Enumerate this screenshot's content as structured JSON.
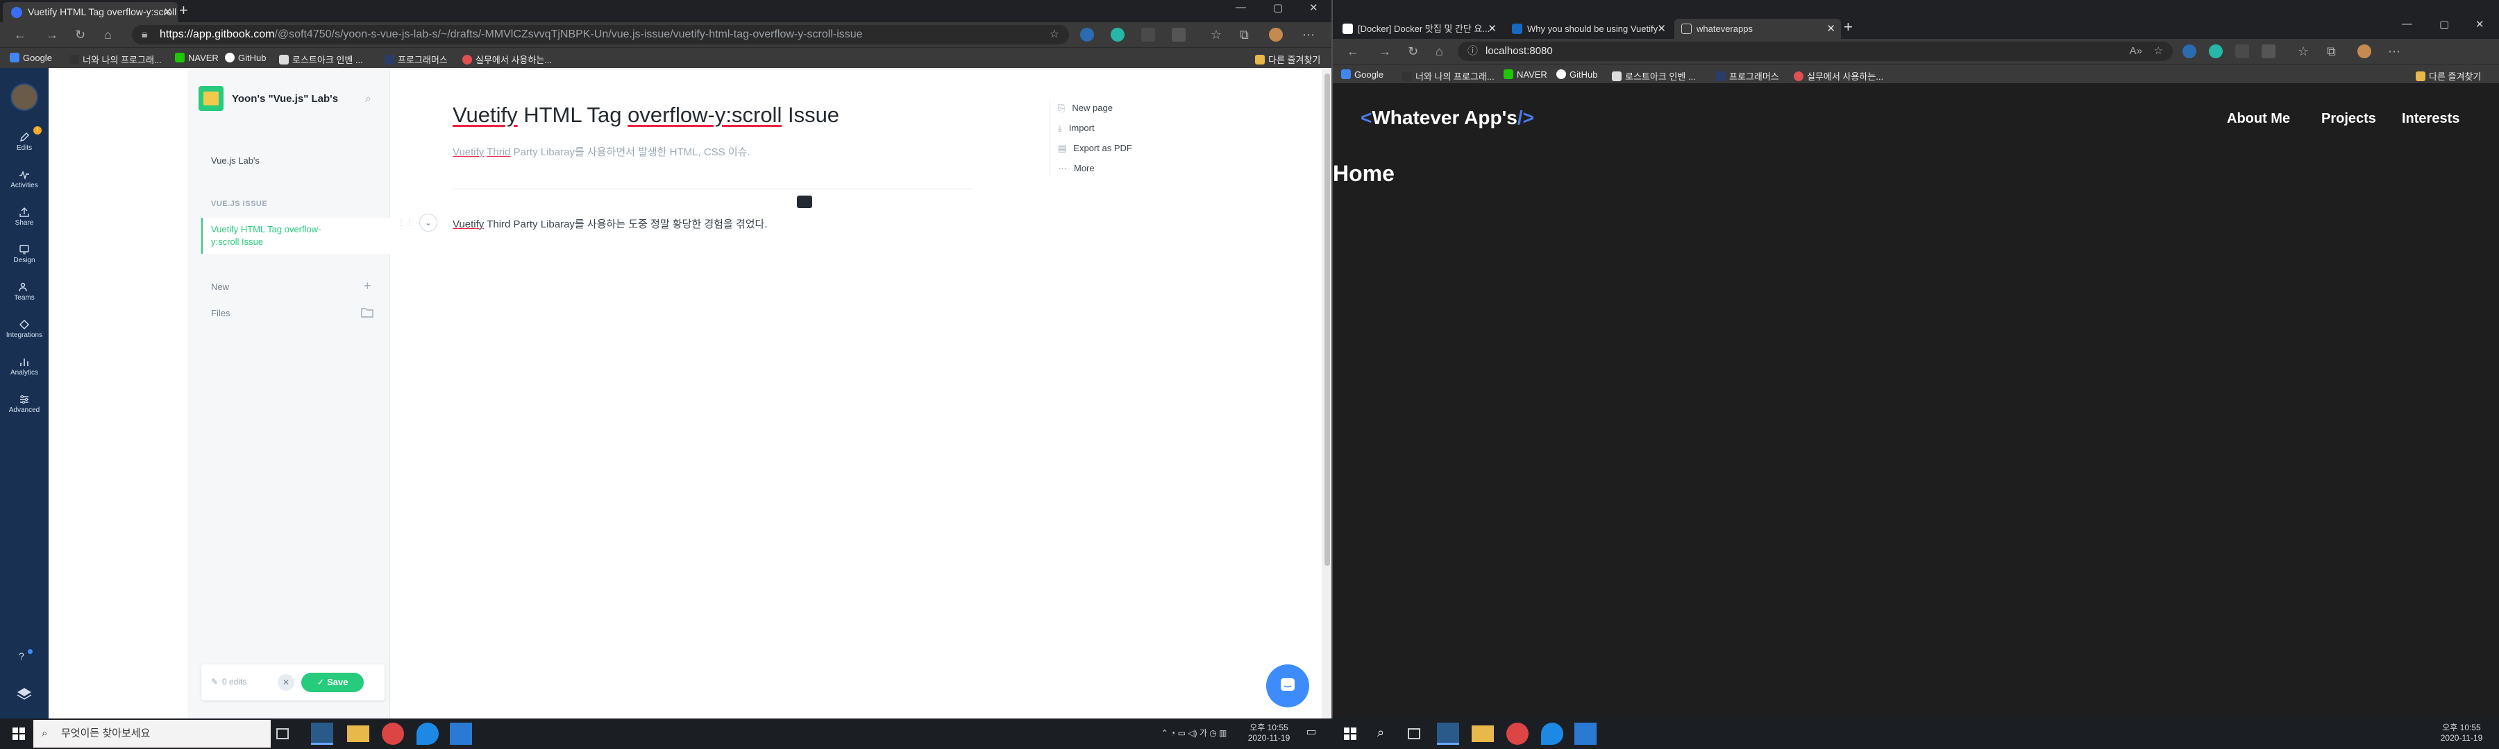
{
  "left_window": {
    "tab": {
      "title": "Vuetify HTML Tag overflow-y:scroll Issue"
    },
    "address_bar": {
      "host": "https://app.gitbook.com",
      "path": "/@soft4750/s/yoon-s-vue-js-lab-s/~/drafts/-MMVlCZsvvqTjNBPK-Un/vue.js-issue/vuetify-html-tag-overflow-y-scroll-issue"
    },
    "bookmarks": [
      "Google",
      "너와 나의 프로그래...",
      "NAVER",
      "GitHub",
      "로스트아크 인벤 ...",
      "프로그래머스",
      "실무에서 사용하는..."
    ],
    "other_bookmarks": "다른 즐겨찾기",
    "rail": [
      {
        "label": "Edits",
        "icon": "pencil-icon"
      },
      {
        "label": "Activities",
        "icon": "activity-icon"
      },
      {
        "label": "Share",
        "icon": "share-icon"
      },
      {
        "label": "Design",
        "icon": "palette-icon"
      },
      {
        "label": "Teams",
        "icon": "team-icon"
      },
      {
        "label": "Integrations",
        "icon": "integrations-icon"
      },
      {
        "label": "Analytics",
        "icon": "analytics-icon"
      },
      {
        "label": "Advanced",
        "icon": "sliders-icon"
      }
    ],
    "space": {
      "name": "Yoon's \"Vue.js\" Lab's",
      "home": "Vue.js Lab's"
    },
    "group": {
      "title": "VUE.JS ISSUE"
    },
    "active_page": "Vuetify HTML Tag overflow-y:scroll Issue",
    "side_actions": {
      "new": "New",
      "files": "Files"
    },
    "editbar": {
      "edits": "0 edits",
      "save": "Save"
    },
    "doc": {
      "title_parts": [
        "Vuetify",
        " HTML Tag ",
        "overflow-y:scroll",
        " Issue"
      ],
      "description_parts": [
        "Vuetify",
        " ",
        "Thrid",
        " Party Libaray를 사용하면서 발생한 HTML, CSS 이슈."
      ],
      "body_parts": [
        "Vuetify",
        " Third Party Libaray를 사용하는 도중 정말 황당한 경험을 겪었다."
      ]
    },
    "page_actions": [
      "New page",
      "Import",
      "Export as PDF",
      "More"
    ],
    "colors": {
      "rail": "#183153",
      "accent": "#26cb7c"
    }
  },
  "right_window": {
    "tabs": [
      "[Docker] Docker 맛집 및 간단 요...",
      "Why you should be using Vuetify",
      "whateverapps"
    ],
    "address": "localhost:8080",
    "bookmarks": [
      "Google",
      "너와 나의 프로그래...",
      "NAVER",
      "GitHub",
      "로스트아크 인벤 ...",
      "프로그래머스",
      "실무에서 사용하는..."
    ],
    "other_bookmarks": "다른 즐겨찾기",
    "brand": {
      "open": "<",
      "name": "Whatever App's",
      "close": "/>"
    },
    "nav": [
      "About Me",
      "Projects",
      "Interests"
    ],
    "heading": "Home"
  },
  "taskbar_left": {
    "search_placeholder": "무엇이든 찾아보세요",
    "time": "오후 10:55",
    "date": "2020-11-19"
  },
  "taskbar_right": {
    "time": "오후 10:55",
    "date": "2020-11-19"
  }
}
